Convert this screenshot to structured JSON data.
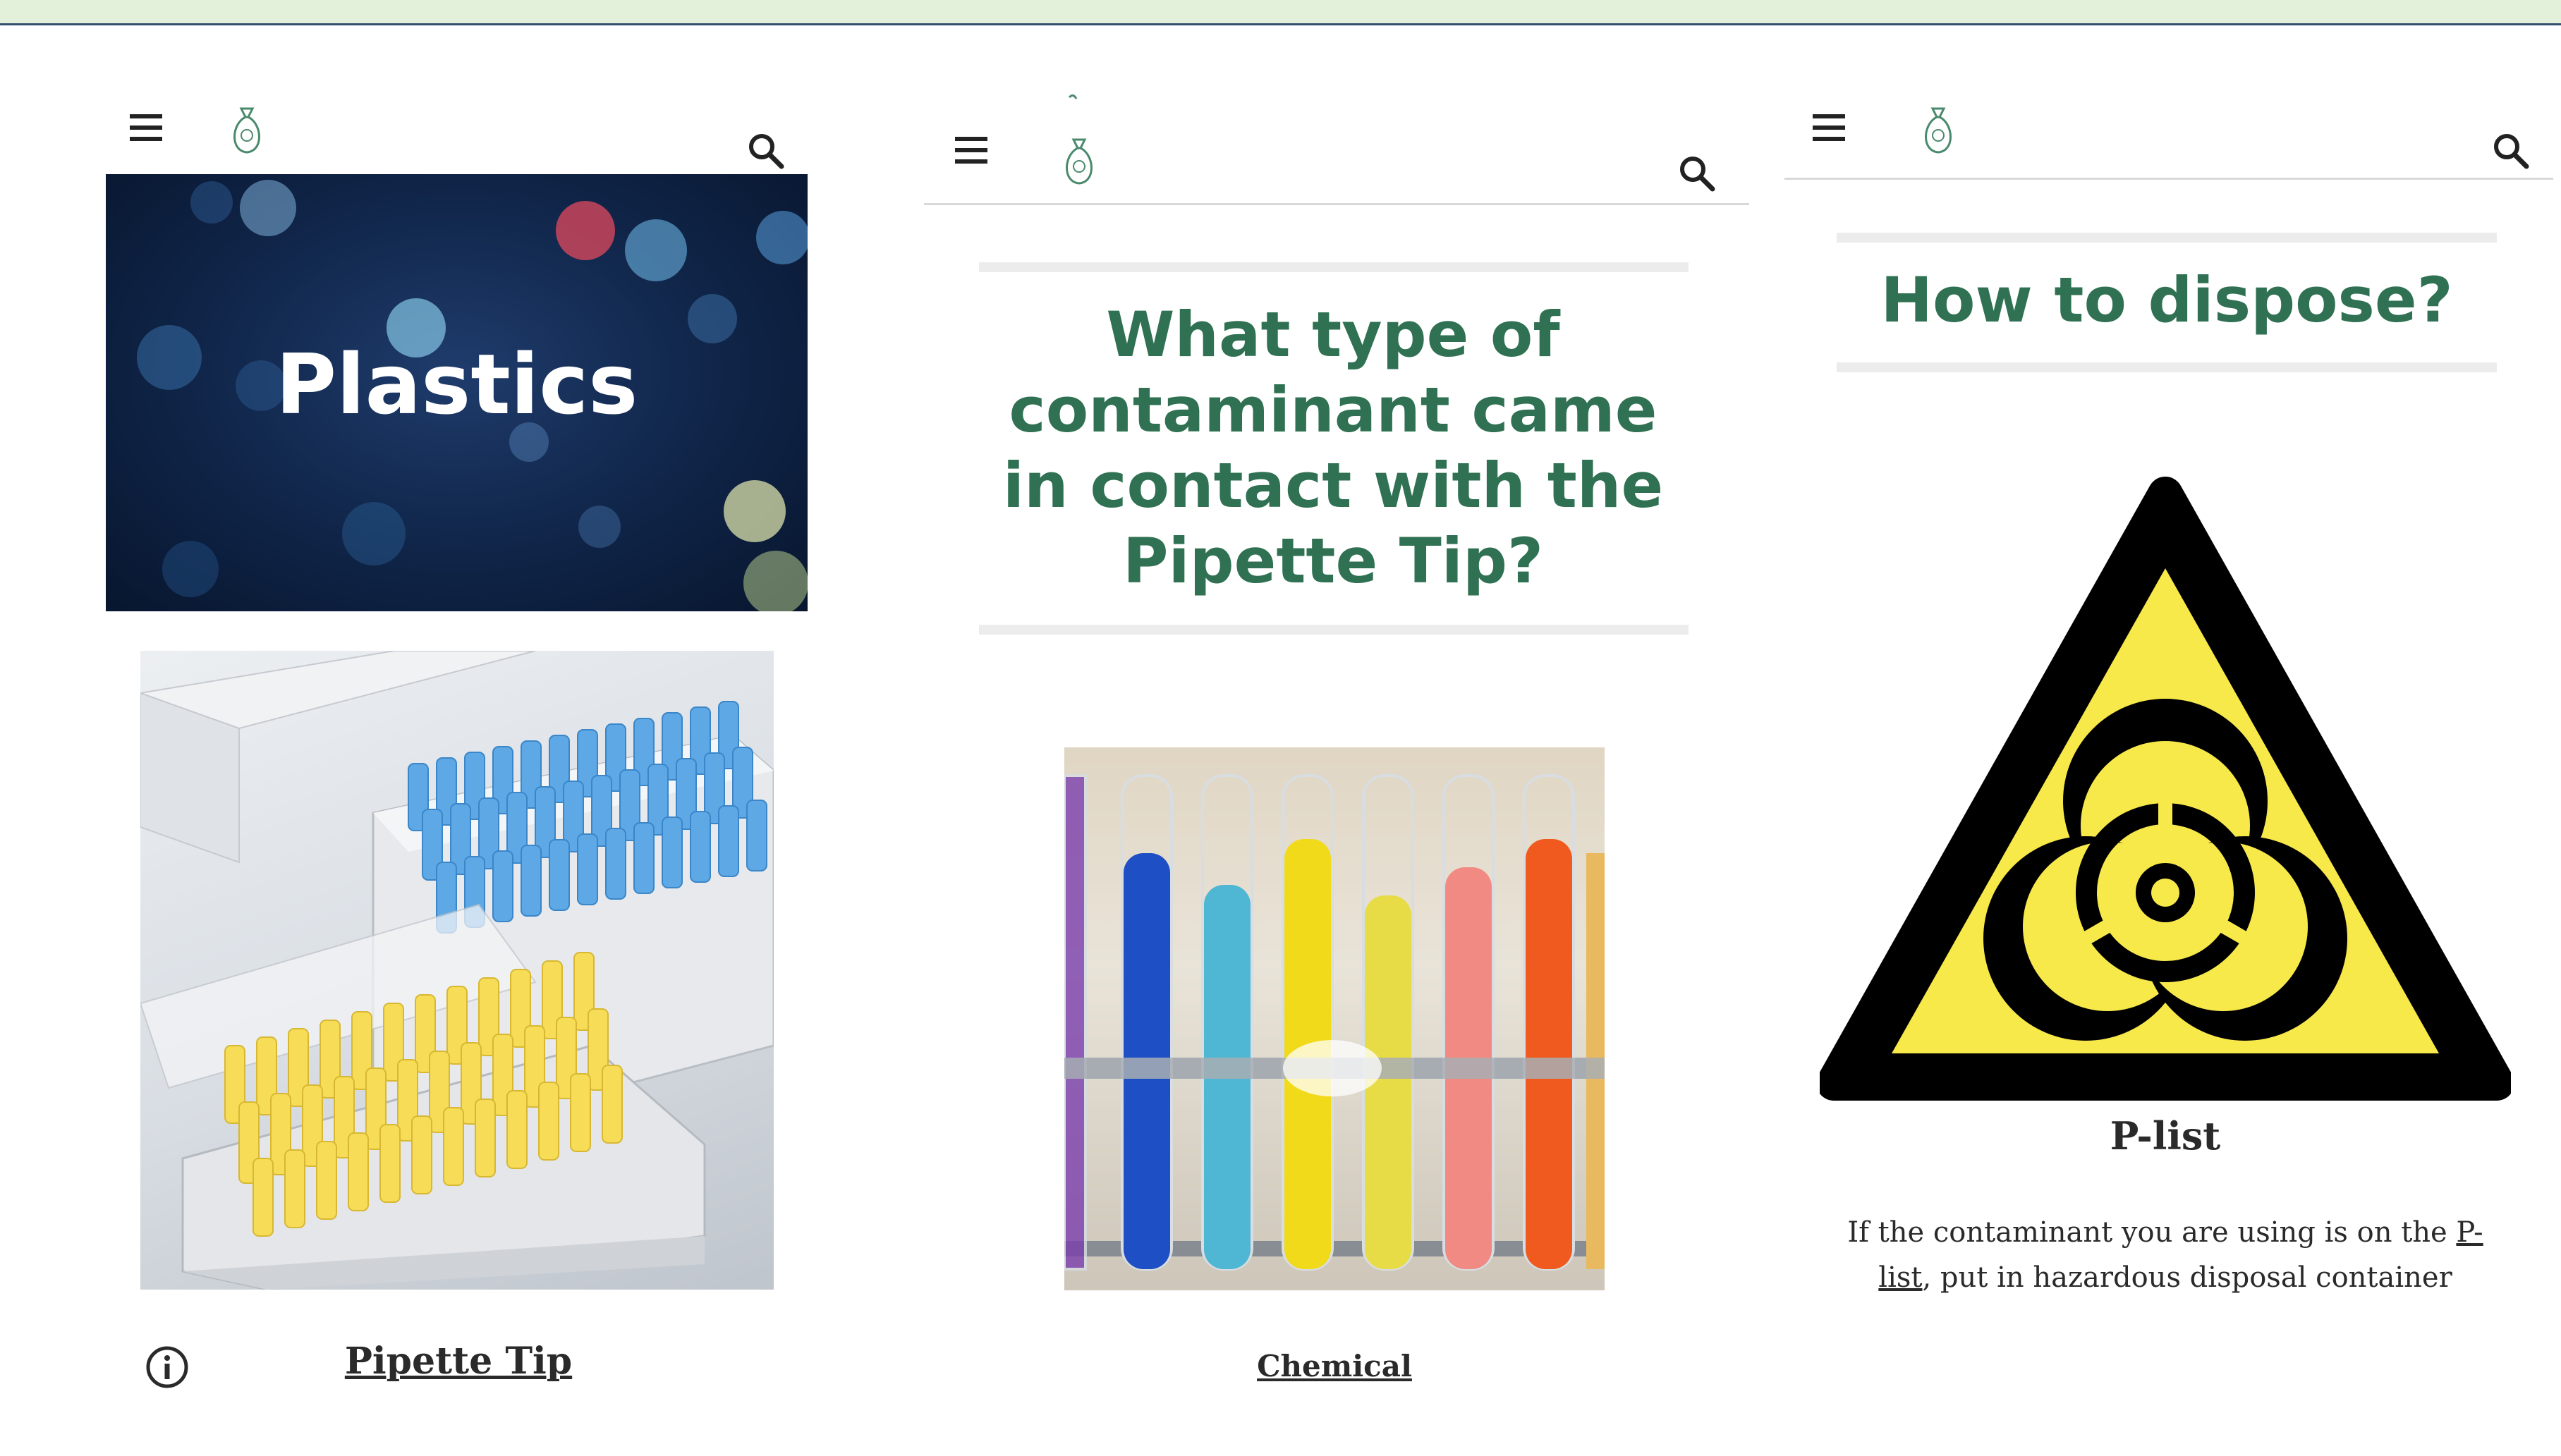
{
  "panels": [
    {
      "banner_title": "Plastics",
      "item_caption": "Pipette Tip",
      "icons": [
        "menu-icon",
        "bag-logo-icon",
        "search-icon",
        "info-icon"
      ]
    },
    {
      "question": "What type of contaminant came in contact with the Pipette Tip?",
      "option_caption": "Chemical",
      "icons": [
        "menu-icon",
        "bag-logo-icon",
        "search-icon"
      ]
    },
    {
      "heading": "How to dispose?",
      "list_title": "P-list",
      "instruction_prefix": "If the contaminant you are using is on the ",
      "instruction_link": "P-list",
      "instruction_suffix": ", put in hazardous disposal container",
      "icons": [
        "menu-icon",
        "bag-logo-icon",
        "search-icon",
        "biohazard-warning-icon"
      ]
    }
  ],
  "colors": {
    "accent_green": "#2f7152",
    "top_strip": "#e3f1db",
    "hazard_yellow": "#f8e94a"
  }
}
